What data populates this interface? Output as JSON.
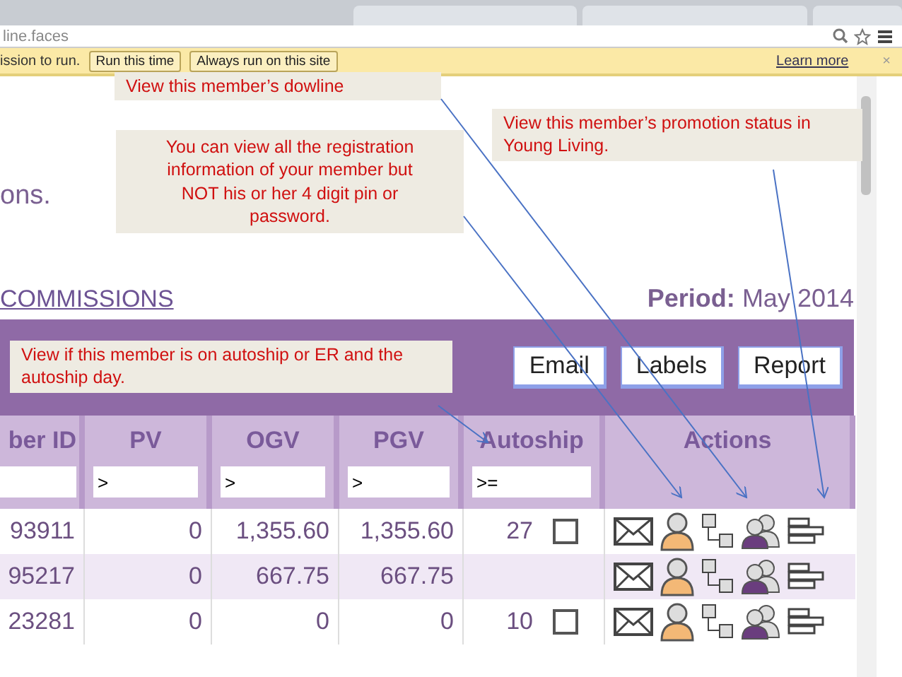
{
  "browser": {
    "address": "line.faces"
  },
  "infobar": {
    "message": "ission to run.",
    "buttons": [
      "Run this time",
      "Always run on this site"
    ],
    "link": "Learn more",
    "close": "×"
  },
  "page": {
    "intro_fragment": "ons.",
    "section_title": "COMMISSIONS",
    "period_label": "Period:",
    "period_value": "May 2014",
    "buttons": [
      "Email",
      "Labels",
      "Report"
    ],
    "table": {
      "columns": [
        {
          "label": "ber ID",
          "kind": "filter"
        },
        {
          "label": "PV",
          "kind": "filter",
          "filter": ">"
        },
        {
          "label": "OGV",
          "kind": "filter",
          "filter": ">"
        },
        {
          "label": "PGV",
          "kind": "filter",
          "filter": ">"
        },
        {
          "label": "Autoship",
          "kind": "filter",
          "filter": ">="
        },
        {
          "label": "Actions",
          "kind": "plain"
        }
      ],
      "rows": [
        {
          "member_id": "93911",
          "pv": "0",
          "ogv": "1,355.60",
          "pgv": "1,355.60",
          "autoship": {
            "day": "27",
            "checked": false
          }
        },
        {
          "member_id": "95217",
          "pv": "0",
          "ogv": "667.75",
          "pgv": "667.75"
        },
        {
          "member_id": "23281",
          "pv": "0",
          "ogv": "0",
          "pgv": "0",
          "autoship": {
            "day": "10",
            "checked": false
          }
        }
      ]
    }
  },
  "annotations": [
    {
      "text": "View this member’s dowline"
    },
    {
      "text": "You can view all the registration information of your member but NOT his or her 4 digit pin or password."
    },
    {
      "text": "View this member’s promotion status in Young Living."
    },
    {
      "text": "View if this member is on autoship or ER and the autoship day."
    }
  ]
}
